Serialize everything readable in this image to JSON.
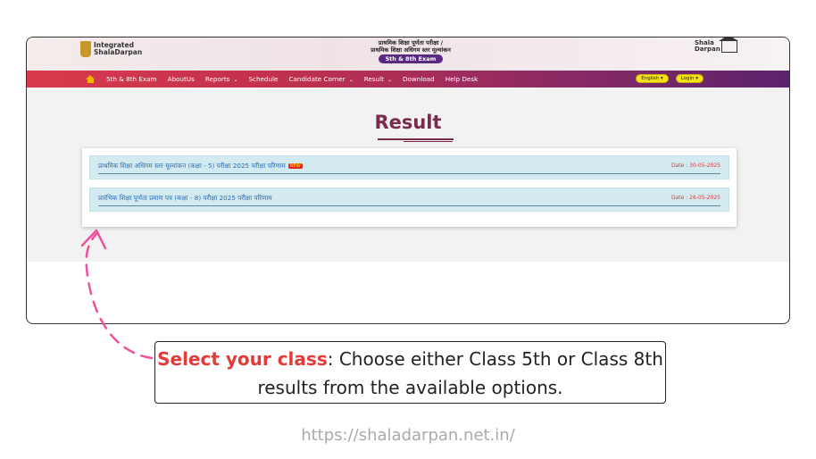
{
  "header": {
    "logo_left_line1": "Integrated",
    "logo_left_line2": "ShalaDarpan",
    "center_line1": "प्राथमिक शिक्षा पूर्णता परीक्षा /",
    "center_line2": "प्राथमिक शिक्षा अधिगम स्तर मूल्यांकन",
    "exam_pill": "5th & 8th Exam",
    "logo_right_line1": "Shala",
    "logo_right_line2": "Darpan"
  },
  "nav": {
    "items": [
      {
        "label": "5th & 8th Exam"
      },
      {
        "label": "AboutUs"
      },
      {
        "label": "Reports"
      },
      {
        "label": "Schedule"
      },
      {
        "label": "Candidate Corner"
      },
      {
        "label": "Result"
      },
      {
        "label": "Download"
      },
      {
        "label": "Help Desk"
      }
    ],
    "caret": "⌄",
    "language_button": "English ▾",
    "login_button": "Login ▾"
  },
  "main": {
    "title": "Result",
    "results": [
      {
        "text": "प्राथमिक शिक्षा अधिगम स्तर मूल्यांकन (कक्षा - 5) परीक्षा 2025 परीक्षा परिणाम",
        "badge": "NEW",
        "date": "Date : 30-05-2025"
      },
      {
        "text": "प्रारंभिक शिक्षा पूर्णता प्रमाण पत्र (कक्षा - 8) परीक्षा 2025 परीक्षा परिणाम",
        "date": "Date : 26-05-2025"
      }
    ]
  },
  "callout": {
    "highlight": "Select your class",
    "rest": ": Choose either Class 5th or Class 8th results from the available options."
  },
  "footer_url": "https://shaladarpan.net.in/",
  "colors": {
    "accent": "#e33a3a",
    "nav_start": "#d83a4a",
    "nav_end": "#5b236d",
    "title": "#7a2a4a"
  }
}
